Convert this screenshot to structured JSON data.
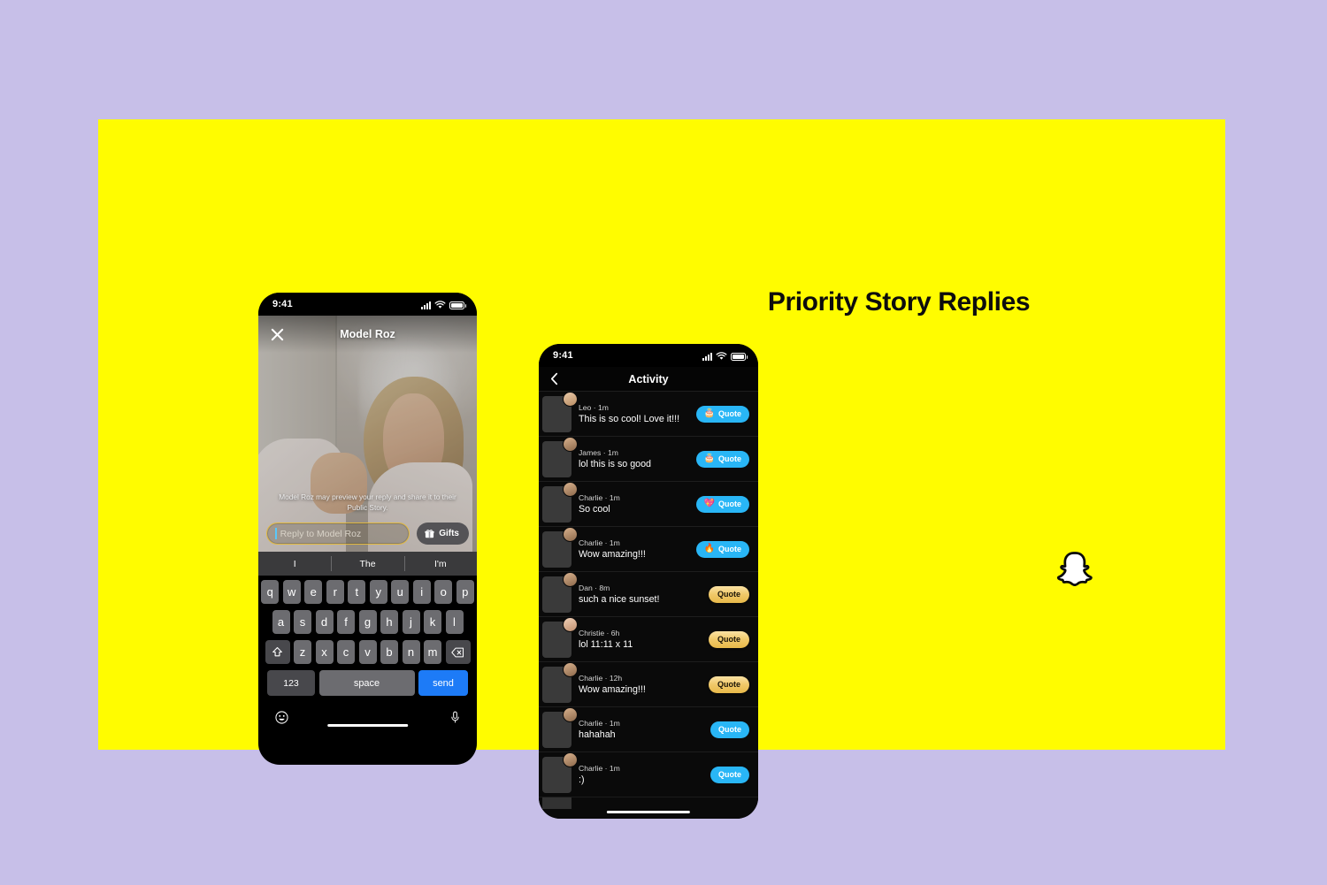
{
  "theme": {
    "page_bg": "#c7bfe8",
    "slide_bg": "#fffc00",
    "accent_blue": "#29b6f6",
    "accent_gold": "#e8b949",
    "text_dark": "#0d0d0d"
  },
  "headline": "Priority Story Replies",
  "brand": {
    "logo_name": "snapchat-ghost-logo"
  },
  "phone_reply": {
    "status_bar": {
      "time": "9:41",
      "signal": "signal-bars-icon",
      "wifi": "wifi-icon",
      "battery": "battery-full-icon"
    },
    "story": {
      "close_label": "close-icon",
      "title": "Model Roz",
      "disclaimer": "Model Roz may preview your reply and share it to their Public Story."
    },
    "reply": {
      "placeholder": "Reply to Model Roz",
      "value": "",
      "gifts_label": "Gifts",
      "gifts_icon": "gift-icon"
    },
    "predictive": [
      "I",
      "The",
      "I'm"
    ],
    "keyboard": {
      "row1": [
        "q",
        "w",
        "e",
        "r",
        "t",
        "y",
        "u",
        "i",
        "o",
        "p"
      ],
      "row2": [
        "a",
        "s",
        "d",
        "f",
        "g",
        "h",
        "j",
        "k",
        "l"
      ],
      "row3": [
        "z",
        "x",
        "c",
        "v",
        "b",
        "n",
        "m"
      ],
      "shift_label": "shift-icon",
      "backspace_label": "backspace-icon",
      "numbers_label": "123",
      "space_label": "space",
      "send_label": "send",
      "emoji_label": "emoji-icon",
      "mic_label": "microphone-icon"
    }
  },
  "phone_activity": {
    "status_bar": {
      "time": "9:41",
      "signal": "signal-bars-icon",
      "wifi": "wifi-icon",
      "battery": "battery-full-icon"
    },
    "header": {
      "back_label": "back-chevron-icon",
      "title": "Activity"
    },
    "quote_label": "Quote",
    "rows": [
      {
        "name": "Leo",
        "time": "1m",
        "message": "This is so cool! Love it!!!",
        "button_style": "blue",
        "emoji": "🎂",
        "emoji_name": "cake-emoji",
        "thumb": "t-room",
        "avatar": "a-leo"
      },
      {
        "name": "James",
        "time": "1m",
        "message": "lol this is so good",
        "button_style": "blue",
        "emoji": "🎂",
        "emoji_name": "cake-emoji",
        "thumb": "t-selfie",
        "avatar": "a-guy"
      },
      {
        "name": "Charlie",
        "time": "1m",
        "message": "So cool",
        "button_style": "blue",
        "emoji": "💖",
        "emoji_name": "pink-heart-emoji",
        "thumb": "t-selfie",
        "avatar": "a-guy"
      },
      {
        "name": "Charlie",
        "time": "1m",
        "message": "Wow amazing!!!",
        "button_style": "blue",
        "emoji": "🔥",
        "emoji_name": "fire-emoji",
        "thumb": "t-selfie",
        "avatar": "a-guy"
      },
      {
        "name": "Dan",
        "time": "8m",
        "message": "such a nice sunset!",
        "button_style": "gold",
        "emoji": "",
        "emoji_name": "",
        "thumb": "t-sunset",
        "avatar": "a-guy"
      },
      {
        "name": "Christie",
        "time": "6h",
        "message": "lol 11:11 x 11",
        "button_style": "gold",
        "emoji": "",
        "emoji_name": "",
        "thumb": "t-car",
        "avatar": "a-girl"
      },
      {
        "name": "Charlie",
        "time": "12h",
        "message": "Wow amazing!!!",
        "button_style": "gold",
        "emoji": "",
        "emoji_name": "",
        "thumb": "t-palm",
        "avatar": "a-guy"
      },
      {
        "name": "Charlie",
        "time": "1m",
        "message": "hahahah",
        "button_style": "blue",
        "emoji": "",
        "emoji_name": "",
        "thumb": "t-selfie",
        "avatar": "a-guy"
      },
      {
        "name": "Charlie",
        "time": "1m",
        "message": ":)",
        "button_style": "blue",
        "emoji": "",
        "emoji_name": "",
        "thumb": "t-selfie",
        "avatar": "a-guy"
      }
    ]
  }
}
